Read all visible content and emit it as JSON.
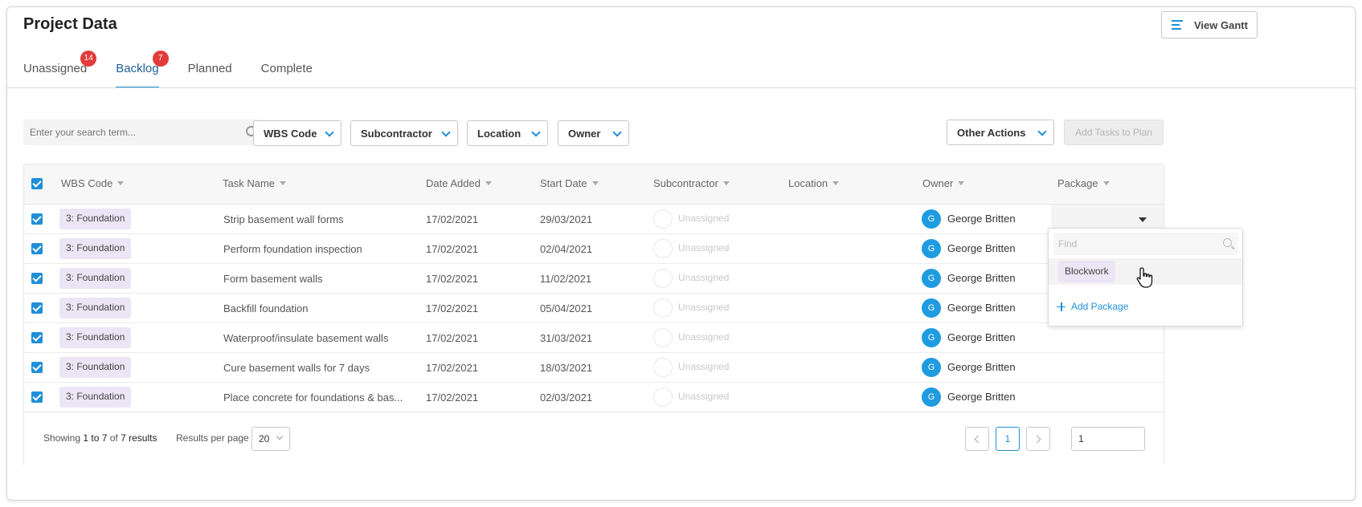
{
  "header": {
    "title": "Project Data",
    "view_gantt_label": "View Gantt"
  },
  "tabs": [
    {
      "label": "Unassigned",
      "badge": "14"
    },
    {
      "label": "Backlog",
      "badge": "7"
    },
    {
      "label": "Planned",
      "badge": ""
    },
    {
      "label": "Complete",
      "badge": ""
    }
  ],
  "filters": {
    "search_placeholder": "Enter your search term...",
    "wbs_code": "WBS Code",
    "subcontractor": "Subcontractor",
    "location": "Location",
    "owner": "Owner",
    "other_actions": "Other Actions",
    "add_tasks": "Add Tasks to Plan"
  },
  "table": {
    "columns": [
      "WBS Code",
      "Task Name",
      "Date Added",
      "Start Date",
      "Subcontractor",
      "Location",
      "Owner",
      "Package"
    ],
    "rows": [
      {
        "wbs": "3: Foundation",
        "task": "Strip basement wall forms",
        "added": "17/02/2021",
        "start": "29/03/2021",
        "sub": "Unassigned",
        "avatar": "G",
        "owner": "George Britten"
      },
      {
        "wbs": "3: Foundation",
        "task": "Perform foundation inspection",
        "added": "17/02/2021",
        "start": "02/04/2021",
        "sub": "Unassigned",
        "avatar": "G",
        "owner": "George Britten"
      },
      {
        "wbs": "3: Foundation",
        "task": "Form basement walls",
        "added": "17/02/2021",
        "start": "11/02/2021",
        "sub": "Unassigned",
        "avatar": "G",
        "owner": "George Britten"
      },
      {
        "wbs": "3: Foundation",
        "task": "Backfill foundation",
        "added": "17/02/2021",
        "start": "05/04/2021",
        "sub": "Unassigned",
        "avatar": "G",
        "owner": "George Britten"
      },
      {
        "wbs": "3: Foundation",
        "task": "Waterproof/insulate basement walls",
        "added": "17/02/2021",
        "start": "31/03/2021",
        "sub": "Unassigned",
        "avatar": "G",
        "owner": "George Britten"
      },
      {
        "wbs": "3: Foundation",
        "task": "Cure basement walls for 7 days",
        "added": "17/02/2021",
        "start": "18/03/2021",
        "sub": "Unassigned",
        "avatar": "G",
        "owner": "George Britten"
      },
      {
        "wbs": "3: Foundation",
        "task": "Place concrete for foundations & bas...",
        "added": "17/02/2021",
        "start": "02/03/2021",
        "sub": "Unassigned",
        "avatar": "G",
        "owner": "George Britten"
      }
    ]
  },
  "footer": {
    "showing_prefix": "Showing",
    "showing_from": "1 to 7",
    "showing_of": "of",
    "showing_total": "7 results",
    "results_per_page_label": "Results per page",
    "results_per_page": "20",
    "current_page": "1",
    "goto_page": "1"
  },
  "package_dropdown": {
    "find_placeholder": "Find",
    "options": [
      "Blockwork"
    ],
    "add_label": "Add Package"
  },
  "colors": {
    "accent": "#1f8fd8",
    "badge": "#e23b3b",
    "tag_bg": "#ece5f6"
  }
}
